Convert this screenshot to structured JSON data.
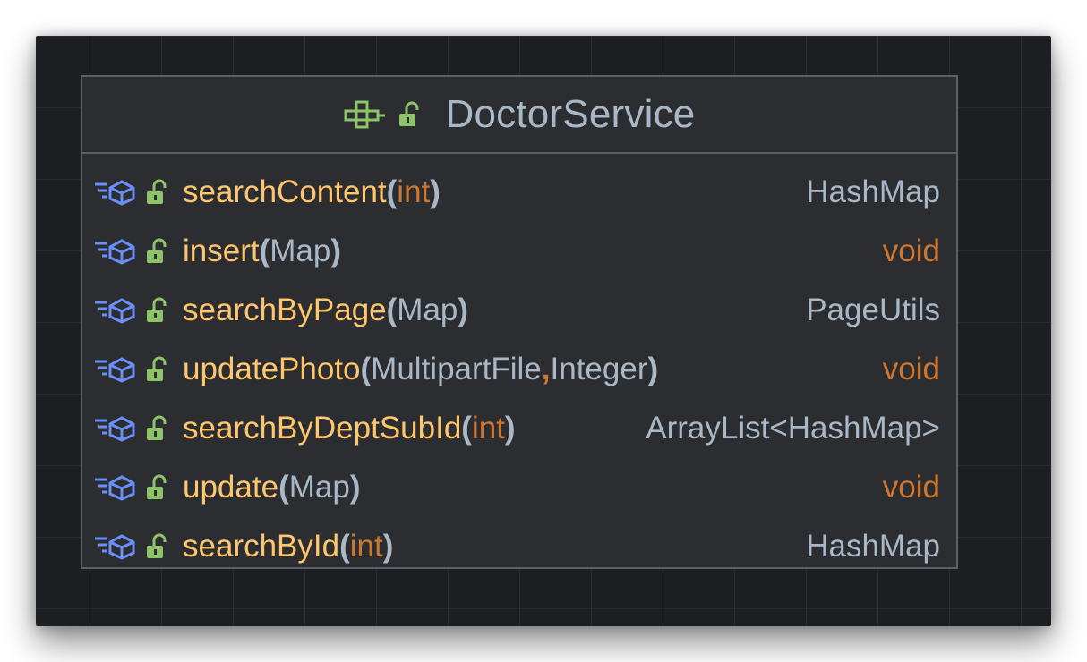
{
  "diagram": {
    "class_name": "DoctorService",
    "class_icon": "interface-icon",
    "visibility_icon": "public-lock-icon",
    "method_icon": "abstract-method-icon",
    "colors": {
      "background": "#1e1f22",
      "panel": "#2b2d30",
      "border": "#5c5f65",
      "method_name": "#ffc66d",
      "type": "#a9b7c6",
      "keyword": "#cc7832",
      "icon_blue": "#6b8ff7",
      "icon_green": "#8ec36a"
    },
    "methods": [
      {
        "name": "searchContent",
        "params": [
          {
            "text": "int",
            "keyword": true
          }
        ],
        "return_type": "HashMap",
        "return_keyword": false
      },
      {
        "name": "insert",
        "params": [
          {
            "text": "Map",
            "keyword": false
          }
        ],
        "return_type": "void",
        "return_keyword": true
      },
      {
        "name": "searchByPage",
        "params": [
          {
            "text": "Map",
            "keyword": false
          }
        ],
        "return_type": "PageUtils",
        "return_keyword": false
      },
      {
        "name": "updatePhoto",
        "params": [
          {
            "text": "MultipartFile",
            "keyword": false
          },
          {
            "text": "Integer",
            "keyword": false
          }
        ],
        "return_type": "void",
        "return_keyword": true
      },
      {
        "name": "searchByDeptSubId",
        "params": [
          {
            "text": "int",
            "keyword": true
          }
        ],
        "return_type": "ArrayList<HashMap>",
        "return_keyword": false
      },
      {
        "name": "update",
        "params": [
          {
            "text": "Map",
            "keyword": false
          }
        ],
        "return_type": "void",
        "return_keyword": true
      },
      {
        "name": "searchById",
        "params": [
          {
            "text": "int",
            "keyword": true
          }
        ],
        "return_type": "HashMap",
        "return_keyword": false
      }
    ]
  }
}
